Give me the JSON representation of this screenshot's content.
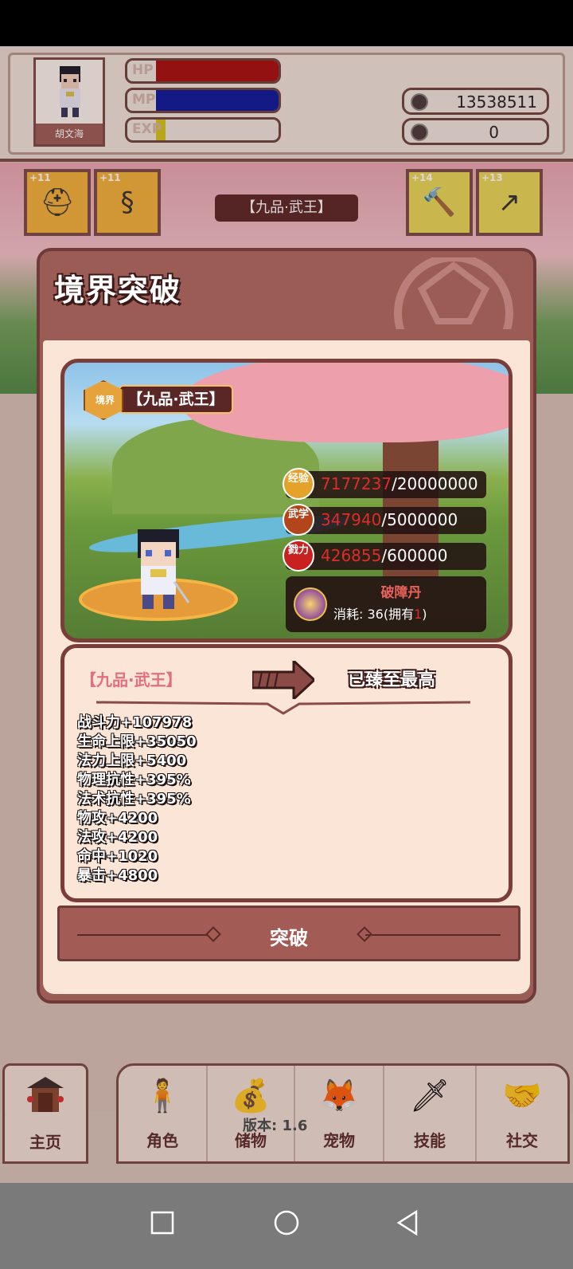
{
  "player": {
    "name": "胡文海",
    "hp_label": "HP",
    "mp_label": "MP",
    "exp_label": "EXP",
    "hp_fraction": 1.0,
    "mp_fraction": 1.0,
    "exp_fraction": 0.08,
    "currency_primary": "13538511",
    "currency_secondary": "0"
  },
  "equipment": {
    "slots": [
      {
        "level": "+11",
        "icon": "helmet-icon"
      },
      {
        "level": "+11",
        "icon": "armor-icon"
      },
      {
        "level": "+14",
        "icon": "hammer-icon"
      },
      {
        "level": "+13",
        "icon": "spear-icon"
      }
    ],
    "realm_text": "【九品·武王】"
  },
  "dialog": {
    "title": "境界突破",
    "realm_badge_label": "境界",
    "current_realm": "【九品·武王】",
    "requirements": [
      {
        "badge": "经验",
        "current": "7177237",
        "total": "/20000000",
        "color": "#e5a22a"
      },
      {
        "badge": "武学",
        "current": "347940",
        "total": "/5000000",
        "color": "#b24519"
      },
      {
        "badge": "戮力",
        "current": "426855",
        "total": "/600000",
        "color": "#c92020"
      }
    ],
    "item": {
      "name": "破障丹",
      "cost_prefix": "消耗: 36(拥有",
      "owned": "1",
      "cost_suffix": ")"
    },
    "from_realm": "【九品·武王】",
    "to_realm": "已臻至最高",
    "bonuses": [
      "战斗力+107978",
      "生命上限+35050",
      "法力上限+5400",
      "物理抗性+395%",
      "法术抗性+395%",
      "物攻+4200",
      "法攻+4200",
      "命中+1020",
      "暴击+4800"
    ],
    "break_button": "突破"
  },
  "nav": {
    "home": "主页",
    "items": [
      {
        "label": "角色",
        "icon": "character-icon"
      },
      {
        "label": "储物",
        "icon": "storage-bag-icon"
      },
      {
        "label": "宠物",
        "icon": "pet-fox-icon"
      },
      {
        "label": "技能",
        "icon": "sword-icon"
      },
      {
        "label": "社交",
        "icon": "handshake-icon"
      }
    ]
  },
  "version_text": "版本: 1.6"
}
